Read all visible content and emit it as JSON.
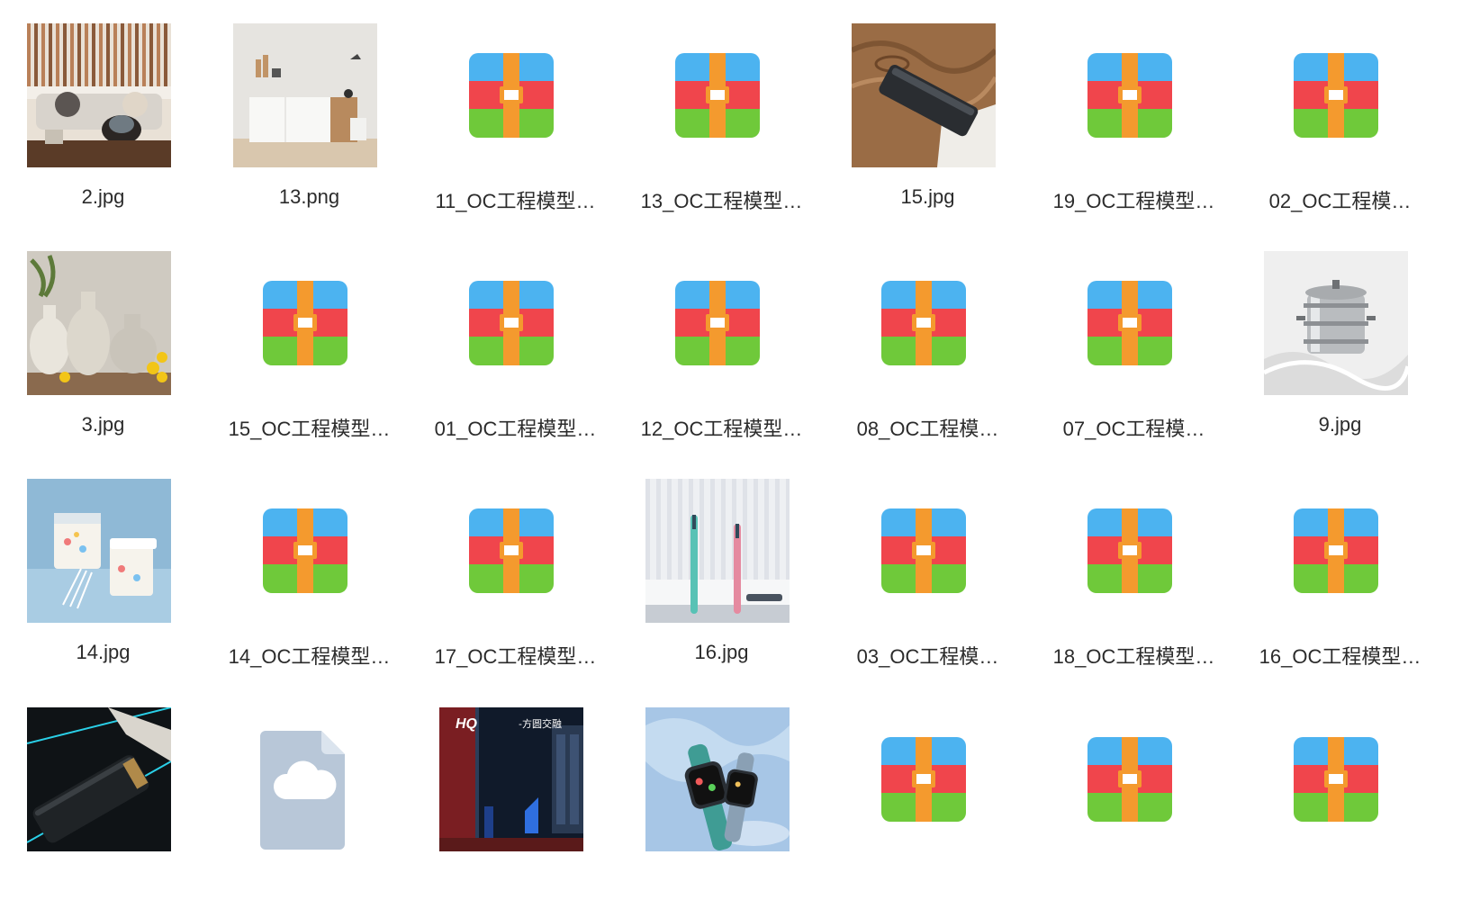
{
  "files": [
    {
      "name": "2.jpg",
      "kind": "image",
      "art": "living-room"
    },
    {
      "name": "13.png",
      "kind": "image",
      "art": "cabinet-room"
    },
    {
      "name": "11_OC工程模型…",
      "kind": "archive",
      "art": "archive-icon"
    },
    {
      "name": "13_OC工程模型…",
      "kind": "archive",
      "art": "archive-icon"
    },
    {
      "name": "15.jpg",
      "kind": "image",
      "art": "powerbank-wood"
    },
    {
      "name": "19_OC工程模型…",
      "kind": "archive",
      "art": "archive-icon"
    },
    {
      "name": "02_OC工程模…",
      "kind": "archive",
      "art": "archive-icon"
    },
    {
      "name": "3.jpg",
      "kind": "image",
      "art": "vases-lemons"
    },
    {
      "name": "15_OC工程模型…",
      "kind": "archive",
      "art": "archive-icon"
    },
    {
      "name": "01_OC工程模型…",
      "kind": "archive",
      "art": "archive-icon"
    },
    {
      "name": "12_OC工程模型…",
      "kind": "archive",
      "art": "archive-icon"
    },
    {
      "name": "08_OC工程模…",
      "kind": "archive",
      "art": "archive-icon"
    },
    {
      "name": "07_OC工程模…",
      "kind": "archive",
      "art": "archive-icon"
    },
    {
      "name": "9.jpg",
      "kind": "image",
      "art": "steamer-pot"
    },
    {
      "name": "14.jpg",
      "kind": "image",
      "art": "cotton-buds-box"
    },
    {
      "name": "14_OC工程模型…",
      "kind": "archive",
      "art": "archive-icon"
    },
    {
      "name": "17_OC工程模型…",
      "kind": "archive",
      "art": "archive-icon"
    },
    {
      "name": "16.jpg",
      "kind": "image",
      "art": "toothbrushes"
    },
    {
      "name": "03_OC工程模…",
      "kind": "archive",
      "art": "archive-icon"
    },
    {
      "name": "18_OC工程模型…",
      "kind": "archive",
      "art": "archive-icon"
    },
    {
      "name": "16_OC工程模型…",
      "kind": "archive",
      "art": "archive-icon"
    },
    {
      "name": "",
      "kind": "image",
      "art": "powerbank-dark"
    },
    {
      "name": "",
      "kind": "cloud-file",
      "art": "cloud-file-icon"
    },
    {
      "name": "",
      "kind": "image",
      "art": "poster-blue"
    },
    {
      "name": "",
      "kind": "image",
      "art": "smartwatches"
    },
    {
      "name": "",
      "kind": "archive",
      "art": "archive-icon"
    },
    {
      "name": "",
      "kind": "archive",
      "art": "archive-icon"
    },
    {
      "name": "",
      "kind": "archive",
      "art": "archive-icon"
    }
  ],
  "poster_text": {
    "brand": "HQ",
    "heading": "-方圆交融"
  },
  "colors": {
    "archive_blue": "#4cb3f0",
    "archive_red": "#f0454c",
    "archive_green": "#6fc93a",
    "archive_orange": "#f49a2e",
    "cloud_file": "#b8c7d8",
    "label_text": "#2b2b2b"
  }
}
